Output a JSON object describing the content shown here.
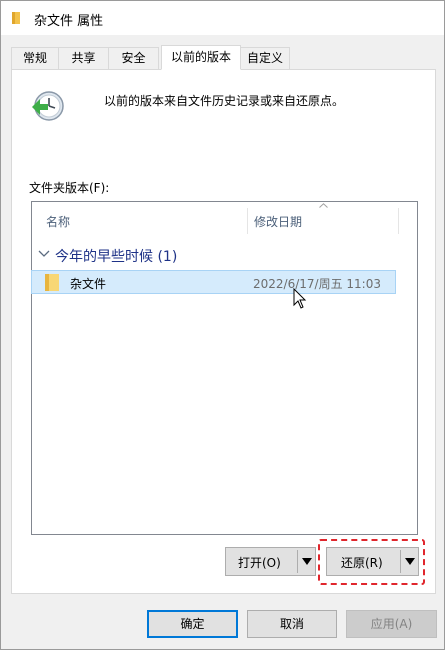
{
  "window": {
    "title": "杂文件 属性"
  },
  "tabs": [
    {
      "label": "常规"
    },
    {
      "label": "共享"
    },
    {
      "label": "安全"
    },
    {
      "label": "以前的版本"
    },
    {
      "label": "自定义"
    }
  ],
  "panel": {
    "description": "以前的版本来自文件历史记录或来自还原点。",
    "folder_versions_label": "文件夹版本(F):",
    "columns": {
      "name": "名称",
      "date": "修改日期"
    },
    "group": {
      "label": "今年的早些时候 (1)"
    },
    "rows": [
      {
        "name": "杂文件",
        "date": "2022/6/17/周五 11:03"
      }
    ],
    "open_button": "打开(O)",
    "restore_button": "还原(R)"
  },
  "footer": {
    "ok": "确定",
    "cancel": "取消",
    "apply": "应用(A)"
  },
  "colors": {
    "accent": "#0078d7",
    "selection": "#cce8ff",
    "group_text": "#1e3287",
    "highlight": "#e0262d"
  }
}
